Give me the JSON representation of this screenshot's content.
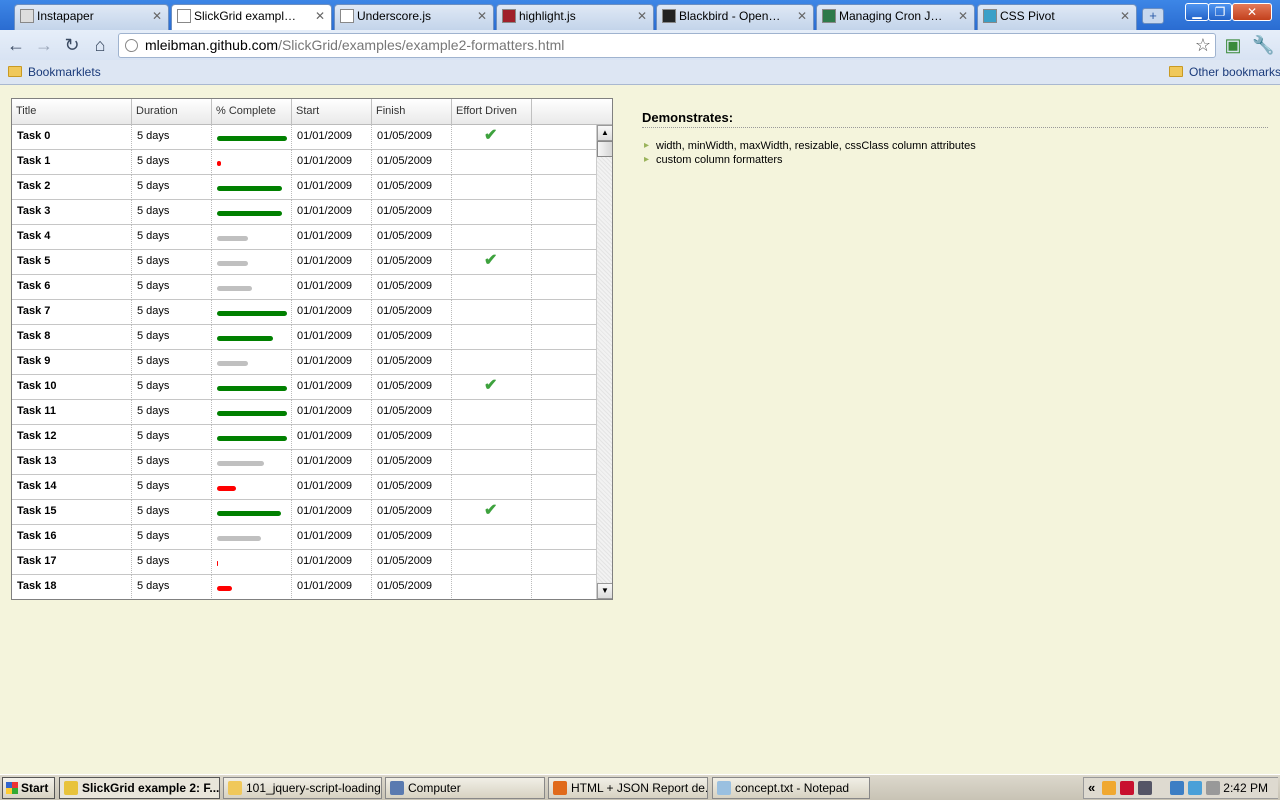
{
  "browser": {
    "tabs": [
      {
        "title": "Instapaper",
        "active": false,
        "icon": "instapaper-icon"
      },
      {
        "title": "SlickGrid example 2: ...",
        "active": true,
        "icon": "page-icon"
      },
      {
        "title": "Underscore.js",
        "active": false,
        "icon": "page-icon"
      },
      {
        "title": "highlight.js",
        "active": false,
        "icon": "highlight-icon"
      },
      {
        "title": "Blackbird - Open So...",
        "active": false,
        "icon": "blackbird-icon"
      },
      {
        "title": "Managing Cron Jobs...",
        "active": false,
        "icon": "plus-green-icon"
      },
      {
        "title": "CSS Pivot",
        "active": false,
        "icon": "css-pivot-icon"
      }
    ],
    "new_tab_label": "+",
    "url_host": "mleibman.github.com",
    "url_path": "/SlickGrid/examples/example2-formatters.html",
    "bookmarks": {
      "left": "Bookmarklets",
      "right": "Other bookmarks"
    }
  },
  "grid": {
    "columns": [
      "Title",
      "Duration",
      "% Complete",
      "Start",
      "Finish",
      "Effort Driven"
    ],
    "rows": [
      {
        "title": "Task 0",
        "duration": "5 days",
        "pct": 95,
        "start": "01/01/2009",
        "finish": "01/05/2009",
        "effort": true
      },
      {
        "title": "Task 1",
        "duration": "5 days",
        "pct": 5,
        "start": "01/01/2009",
        "finish": "01/05/2009",
        "effort": false
      },
      {
        "title": "Task 2",
        "duration": "5 days",
        "pct": 88,
        "start": "01/01/2009",
        "finish": "01/05/2009",
        "effort": false
      },
      {
        "title": "Task 3",
        "duration": "5 days",
        "pct": 88,
        "start": "01/01/2009",
        "finish": "01/05/2009",
        "effort": false
      },
      {
        "title": "Task 4",
        "duration": "5 days",
        "pct": 42,
        "start": "01/01/2009",
        "finish": "01/05/2009",
        "effort": false
      },
      {
        "title": "Task 5",
        "duration": "5 days",
        "pct": 42,
        "start": "01/01/2009",
        "finish": "01/05/2009",
        "effort": true
      },
      {
        "title": "Task 6",
        "duration": "5 days",
        "pct": 47,
        "start": "01/01/2009",
        "finish": "01/05/2009",
        "effort": false
      },
      {
        "title": "Task 7",
        "duration": "5 days",
        "pct": 95,
        "start": "01/01/2009",
        "finish": "01/05/2009",
        "effort": false
      },
      {
        "title": "Task 8",
        "duration": "5 days",
        "pct": 75,
        "start": "01/01/2009",
        "finish": "01/05/2009",
        "effort": false
      },
      {
        "title": "Task 9",
        "duration": "5 days",
        "pct": 42,
        "start": "01/01/2009",
        "finish": "01/05/2009",
        "effort": false
      },
      {
        "title": "Task 10",
        "duration": "5 days",
        "pct": 95,
        "start": "01/01/2009",
        "finish": "01/05/2009",
        "effort": true
      },
      {
        "title": "Task 11",
        "duration": "5 days",
        "pct": 95,
        "start": "01/01/2009",
        "finish": "01/05/2009",
        "effort": false
      },
      {
        "title": "Task 12",
        "duration": "5 days",
        "pct": 95,
        "start": "01/01/2009",
        "finish": "01/05/2009",
        "effort": false
      },
      {
        "title": "Task 13",
        "duration": "5 days",
        "pct": 64,
        "start": "01/01/2009",
        "finish": "01/05/2009",
        "effort": false
      },
      {
        "title": "Task 14",
        "duration": "5 days",
        "pct": 26,
        "start": "01/01/2009",
        "finish": "01/05/2009",
        "effort": false
      },
      {
        "title": "Task 15",
        "duration": "5 days",
        "pct": 86,
        "start": "01/01/2009",
        "finish": "01/05/2009",
        "effort": true
      },
      {
        "title": "Task 16",
        "duration": "5 days",
        "pct": 60,
        "start": "01/01/2009",
        "finish": "01/05/2009",
        "effort": false
      },
      {
        "title": "Task 17",
        "duration": "5 days",
        "pct": 2,
        "start": "01/01/2009",
        "finish": "01/05/2009",
        "effort": false
      },
      {
        "title": "Task 18",
        "duration": "5 days",
        "pct": 20,
        "start": "01/01/2009",
        "finish": "01/05/2009",
        "effort": false
      }
    ],
    "colors": {
      "high": "#008000",
      "medium": "#c0c0c0",
      "low": "#ff0000"
    }
  },
  "demo": {
    "title": "Demonstrates:",
    "items": [
      "width, minWidth, maxWidth, resizable, cssClass column attributes",
      "custom column formatters"
    ]
  },
  "taskbar": {
    "start_label": "Start",
    "buttons": [
      {
        "label": "SlickGrid example 2: F...",
        "active": true,
        "icon": "chrome-icon"
      },
      {
        "label": "101_jquery-script-loading",
        "active": false,
        "icon": "folder-icon"
      },
      {
        "label": "Computer",
        "active": false,
        "icon": "computer-icon"
      },
      {
        "label": "HTML + JSON Report de...",
        "active": false,
        "icon": "firefox-icon"
      },
      {
        "label": "concept.txt - Notepad",
        "active": false,
        "icon": "notepad-icon"
      }
    ],
    "tray_expand": "«",
    "clock": "2:42 PM"
  }
}
